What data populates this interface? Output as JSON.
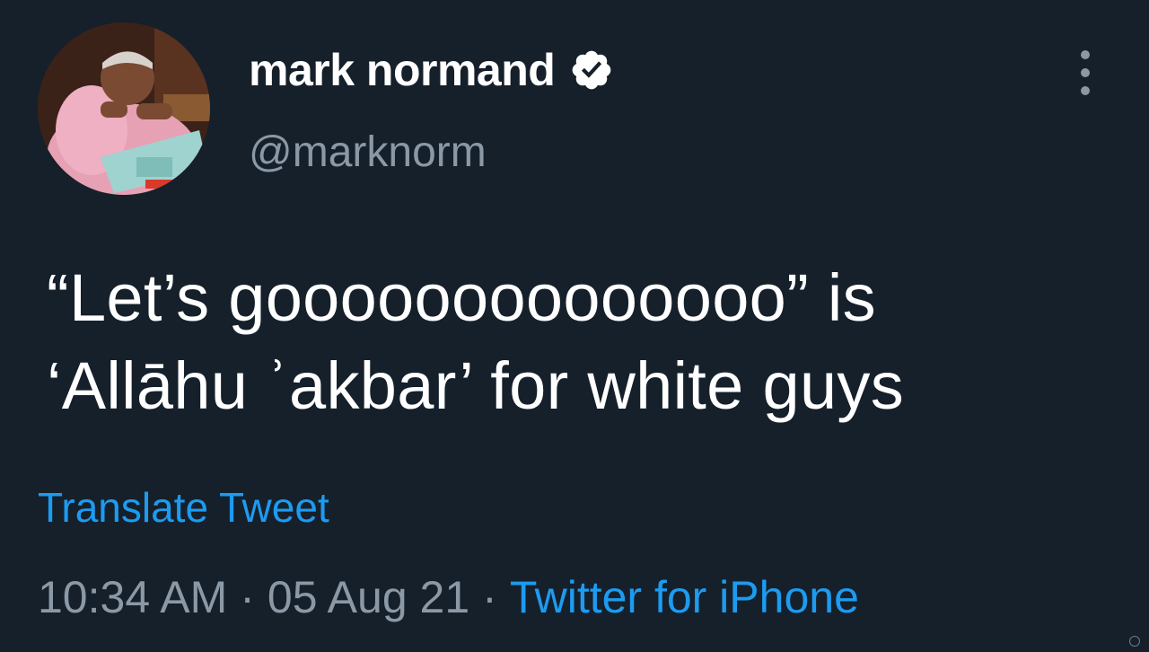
{
  "author": {
    "display_name": "mark normand",
    "handle": "@marknorm",
    "verified": true
  },
  "tweet": {
    "text_lines": [
      "“Let’s goooooooooooooo” is",
      "‘Allāhu ʾakbar’ for white guys"
    ],
    "translate_label": "Translate Tweet",
    "time": "10:34 AM",
    "separator": "·",
    "date": "05 Aug 21",
    "source": "Twitter for iPhone"
  },
  "icons": {
    "verified": "verified-badge-icon",
    "more": "more-options-icon"
  },
  "colors": {
    "background": "#15202b",
    "primary_text": "#ffffff",
    "secondary_text": "#8b98a5",
    "link": "#1d9bf0"
  }
}
